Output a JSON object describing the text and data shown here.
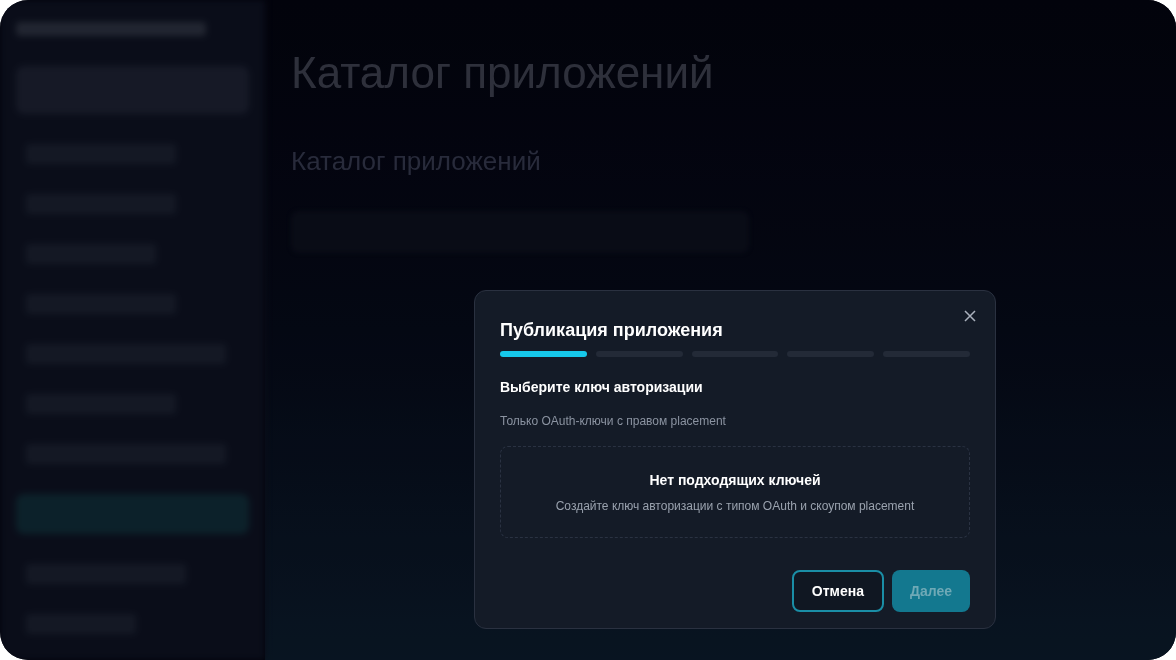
{
  "background": {
    "page_title": "Каталог приложений",
    "section_title": "Каталог приложений"
  },
  "dialog": {
    "title": "Публикация приложения",
    "steps": [
      {
        "selected": true
      },
      {
        "selected": false
      },
      {
        "selected": false
      },
      {
        "selected": false
      },
      {
        "selected": false
      }
    ],
    "heading": "Выберите ключ авторизации",
    "hint": "Только OAuth-ключи с правом placement",
    "empty_state": {
      "title": "Нет подходящих ключей",
      "text": "Создайте ключ авторизации с типом OAuth и скоупом placement"
    },
    "buttons": [
      {
        "label": "Отмена",
        "kind": "secondary",
        "disabled": false
      },
      {
        "label": "Далее",
        "kind": "primary",
        "disabled": true
      }
    ]
  }
}
